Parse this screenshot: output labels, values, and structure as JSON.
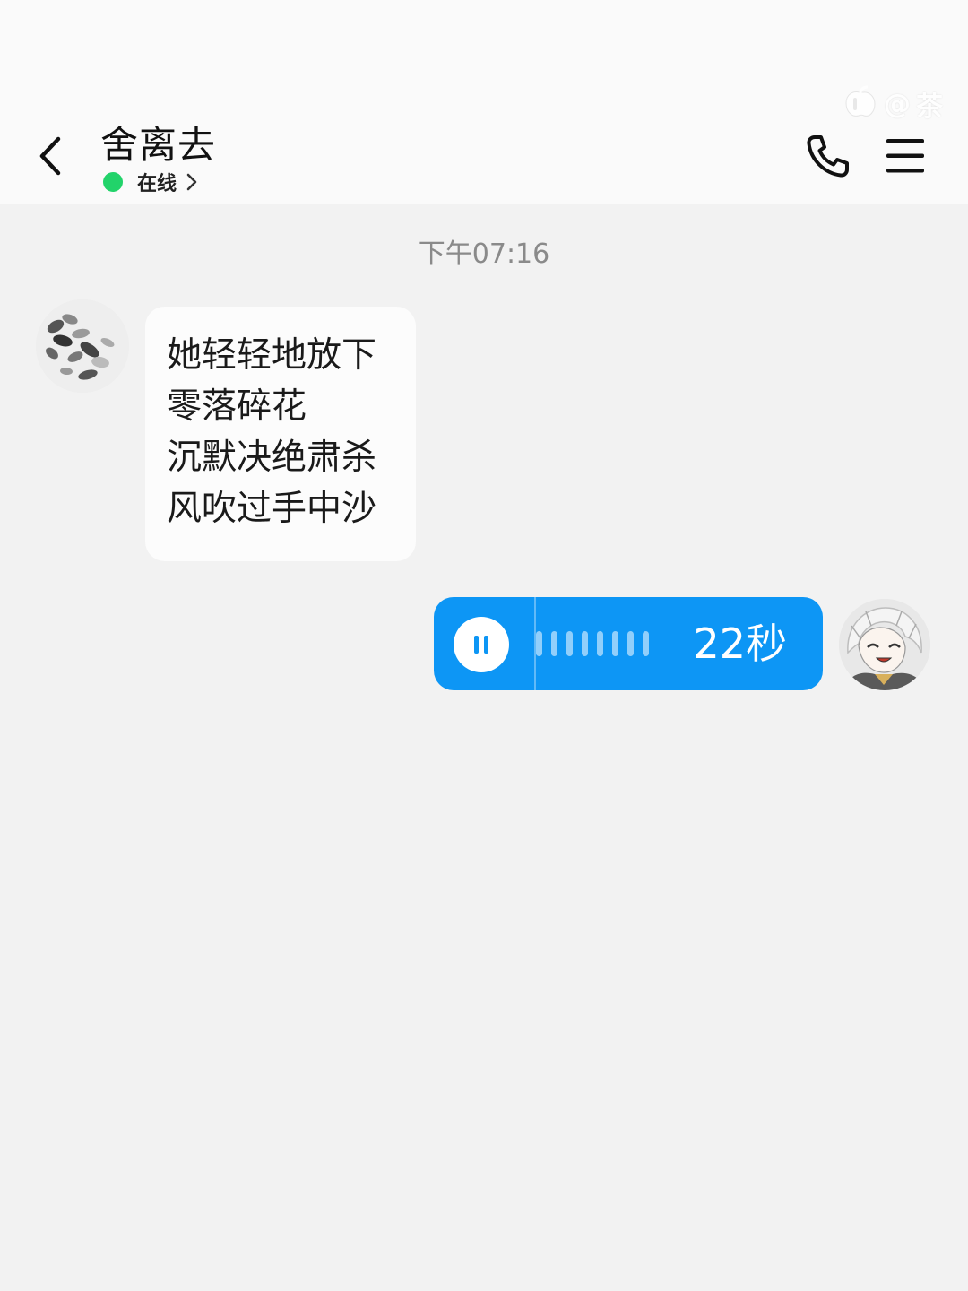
{
  "header": {
    "contact_name": "舍离去",
    "status": "在线",
    "status_color": "#22d36a",
    "watermark": {
      "icon": "app-logo-icon",
      "at": "@",
      "text": "茶"
    }
  },
  "chat": {
    "timestamp": "下午07:16",
    "incoming_message": {
      "avatar": "avatar-leaves",
      "lines": [
        "她轻轻地放下",
        "零落碎花",
        "沉默决绝肃杀",
        "风吹过手中沙"
      ]
    },
    "outgoing_voice": {
      "avatar": "avatar-anime-character",
      "duration": "22秒",
      "state": "playing",
      "bubble_color": "#0d96f5"
    }
  }
}
